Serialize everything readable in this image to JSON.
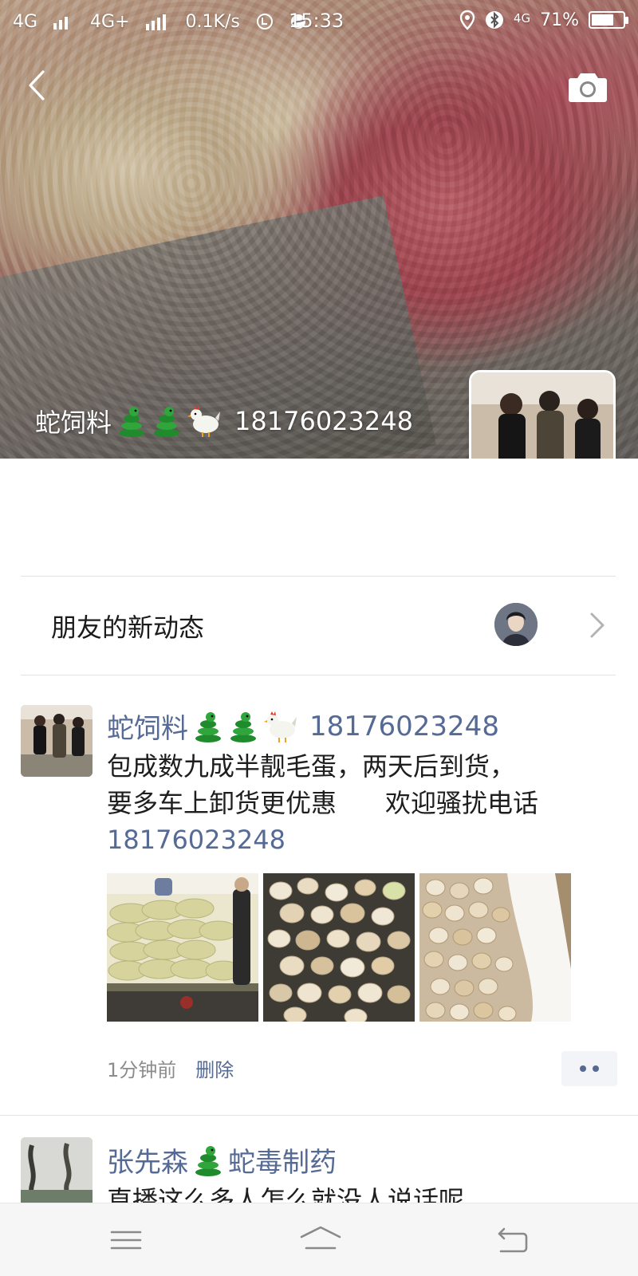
{
  "status_bar": {
    "network1": "4G",
    "network2": "4G+",
    "speed": "0.1K/s",
    "time": "15:33",
    "network3": "4G",
    "battery": "71%",
    "battery_level": 0.71
  },
  "cover": {
    "name_prefix": "蛇饲料",
    "phone": "18176023248"
  },
  "notice": {
    "title": "朋友的新动态"
  },
  "posts": [
    {
      "name_prefix": "蛇饲料",
      "phone": "18176023248",
      "text_line1": "包成数九成半靓毛蛋，两天后到货，",
      "text_line2": "要多车上卸货更优惠      欢迎骚扰电话",
      "text_phone": "18176023248",
      "time": "1分钟前",
      "delete_label": "删除"
    },
    {
      "name_prefix": "张先森",
      "name_suffix": "蛇毒制药",
      "text_line1": "直播这么多人怎么就没人说话呢"
    }
  ],
  "icons": {
    "back": "chevron-left-icon",
    "camera": "camera-icon",
    "snake": "snake-emoji-icon",
    "chicken": "chicken-emoji-icon",
    "chevron": "chevron-right-icon",
    "more": "more-dots-icon",
    "menu": "menu-icon",
    "home": "home-icon",
    "back_nav": "back-nav-icon"
  },
  "colors": {
    "link_blue": "#556a94",
    "text": "#1e1e1e",
    "meta_gray": "#8c8c8c"
  }
}
